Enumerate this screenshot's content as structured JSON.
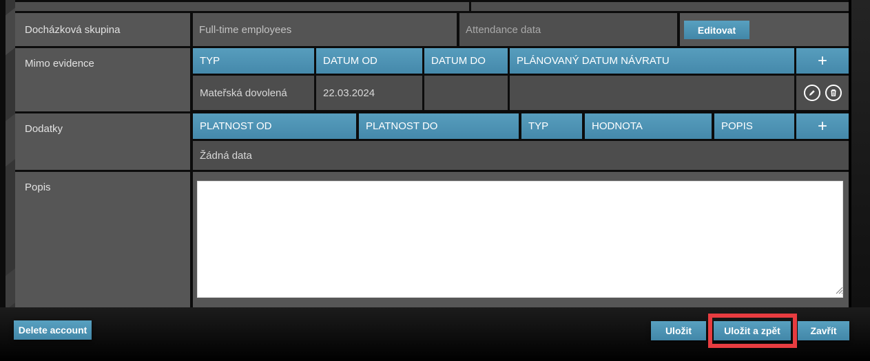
{
  "colors": {
    "accent_blue": "#4b93b5",
    "highlight_red": "#e73c40",
    "row_bg": "#565656",
    "cell_bg": "#4d4d4d"
  },
  "fields": {
    "attendance_group": {
      "label": "Docházková skupina",
      "group_value": "Full-time employees",
      "data_value": "Attendance data",
      "edit_button": "Editovat"
    },
    "mimo_evidence": {
      "label": "Mimo evidence",
      "headers": [
        "TYP",
        "DATUM OD",
        "DATUM DO",
        "PLÁNOVANÝ DATUM NÁVRATU"
      ],
      "add_button": "+",
      "rows": [
        {
          "typ": "Mateřská dovolená",
          "datum_od": "22.03.2024",
          "datum_do": "",
          "planovany_datum_navratu": ""
        }
      ],
      "row_action_icons": {
        "edit": "pencil-in-circle",
        "delete": "trash-in-circle"
      }
    },
    "dodatky": {
      "label": "Dodatky",
      "headers": [
        "PLATNOST OD",
        "PLATNOST DO",
        "TYP",
        "HODNOTA",
        "POPIS"
      ],
      "add_button": "+",
      "empty_text": "Žádná data"
    },
    "popis": {
      "label": "Popis",
      "value": ""
    }
  },
  "footer": {
    "delete_account": "Delete account",
    "save": "Uložit",
    "save_and_back": "Uložit a zpět",
    "close": "Zavřít"
  }
}
